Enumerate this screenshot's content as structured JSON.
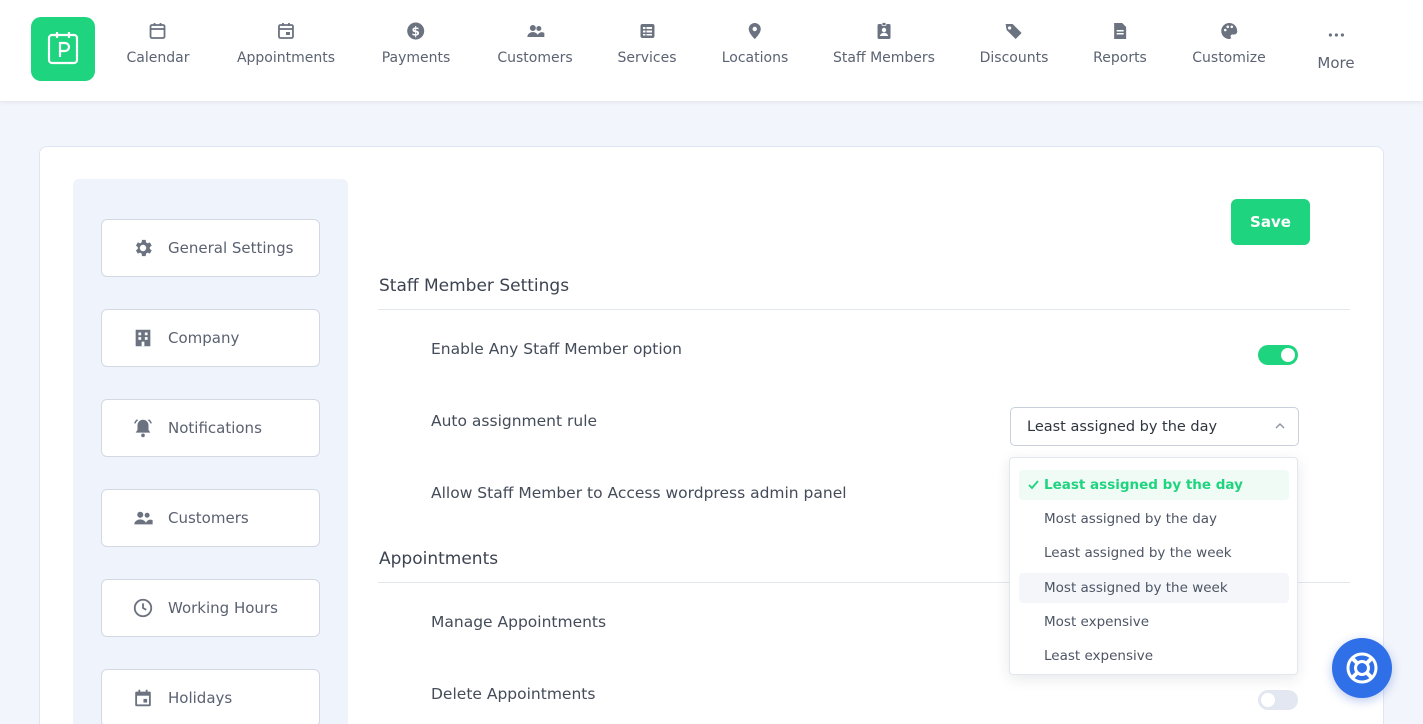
{
  "colors": {
    "accent": "#1ed47f",
    "help": "#2f6fe8"
  },
  "nav": [
    {
      "label": "Calendar",
      "icon": "calendar-icon"
    },
    {
      "label": "Appointments",
      "icon": "calendar-event-icon"
    },
    {
      "label": "Payments",
      "icon": "dollar-icon"
    },
    {
      "label": "Customers",
      "icon": "users-icon"
    },
    {
      "label": "Services",
      "icon": "list-icon"
    },
    {
      "label": "Locations",
      "icon": "pin-icon"
    },
    {
      "label": "Staff Members",
      "icon": "badge-icon"
    },
    {
      "label": "Discounts",
      "icon": "tag-icon"
    },
    {
      "label": "Reports",
      "icon": "file-icon"
    },
    {
      "label": "Customize",
      "icon": "palette-icon"
    },
    {
      "label": "More",
      "icon": "dots-icon"
    }
  ],
  "sidebar": [
    {
      "label": "General Settings",
      "icon": "gear-icon"
    },
    {
      "label": "Company",
      "icon": "building-icon"
    },
    {
      "label": "Notifications",
      "icon": "bell-icon"
    },
    {
      "label": "Customers",
      "icon": "users-icon"
    },
    {
      "label": "Working Hours",
      "icon": "clock-icon"
    },
    {
      "label": "Holidays",
      "icon": "calendar-icon"
    }
  ],
  "save_label": "Save",
  "staff_section": {
    "title": "Staff Member Settings",
    "enable_any_label": "Enable Any Staff Member option",
    "enable_any_on": true,
    "auto_assign_label": "Auto assignment rule",
    "auto_assign_value": "Least assigned by the day",
    "allow_admin_label": "Allow Staff Member to Access wordpress admin panel"
  },
  "dropdown_options": [
    "Least assigned by the day",
    "Most assigned by the day",
    "Least assigned by the week",
    "Most assigned by the week",
    "Most expensive",
    "Least expensive"
  ],
  "appointments_section": {
    "title": "Appointments",
    "manage_label": "Manage Appointments",
    "delete_label": "Delete Appointments",
    "delete_on": false
  }
}
